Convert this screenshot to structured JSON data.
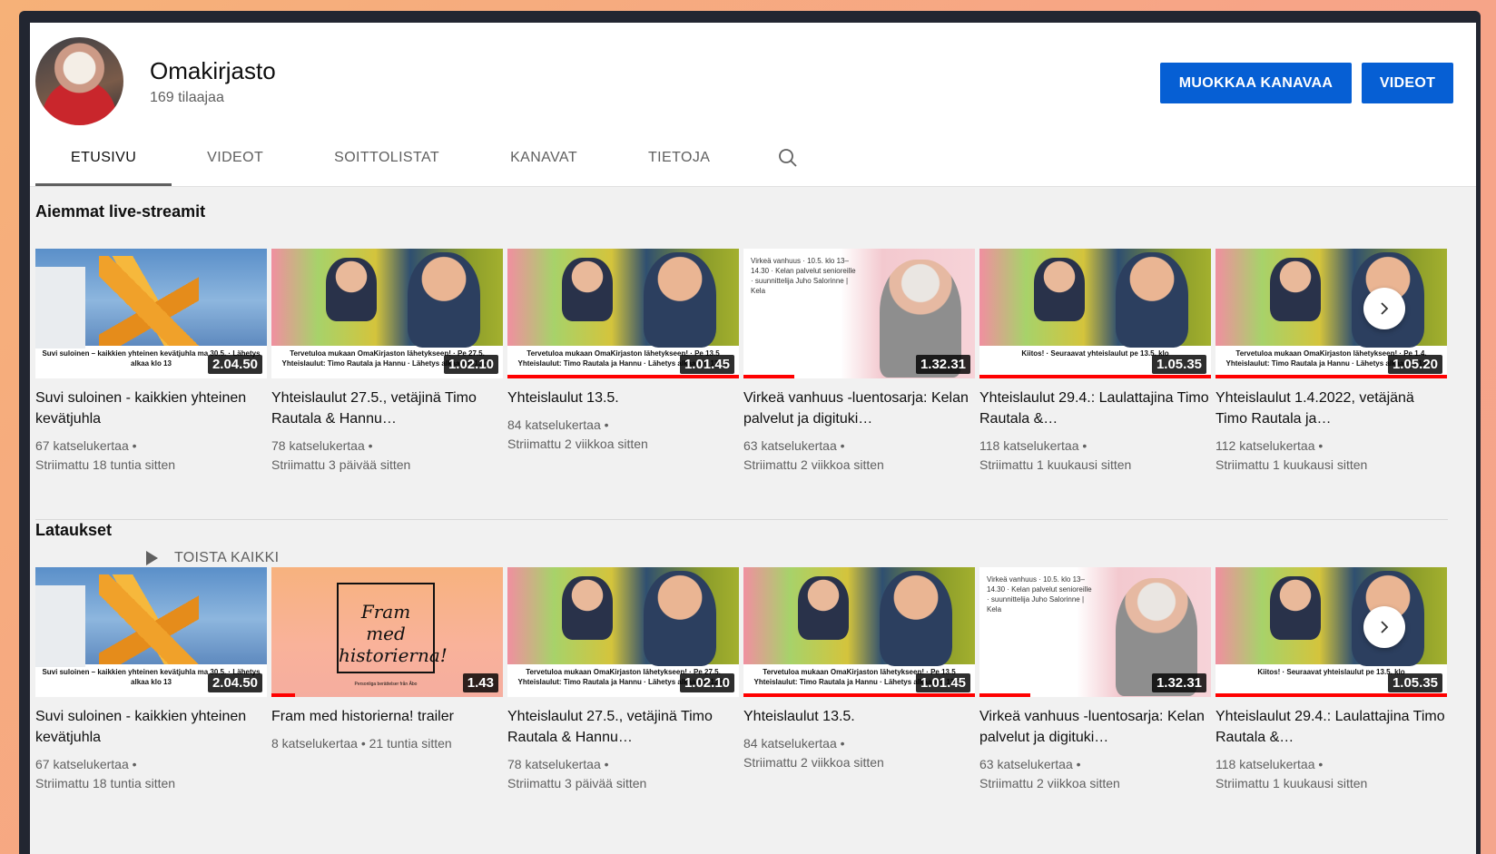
{
  "channel": {
    "name": "Omakirjasto",
    "subscribers": "169 tilaajaa",
    "edit_button": "MUOKKAA KANAVAA",
    "videos_button": "VIDEOT"
  },
  "tabs": [
    "ETUSIVU",
    "VIDEOT",
    "SOITTOLISTAT",
    "KANAVAT",
    "TIETOJA"
  ],
  "colors": {
    "accent": "#065fd4",
    "progress": "#ff0000"
  },
  "sections": {
    "live": {
      "title": "Aiemmat live-streamit",
      "videos": [
        {
          "title": "Suvi suloinen - kaikkien yhteinen kevätjuhla",
          "views": "67 katselukertaa •",
          "time": "Striimattu 18 tuntia sitten",
          "duration": "2.04.50",
          "progress": 0,
          "thumb": "sculpture",
          "caption": "Suvi suloinen – kaikkien yhteinen kevätjuhla ma 30.5. · Lähetys alkaa klo 13"
        },
        {
          "title": "Yhteislaulut 27.5., vetäjinä Timo Rautala & Hannu…",
          "views": "78 katselukertaa •",
          "time": "Striimattu 3 päivää sitten",
          "duration": "1.02.10",
          "progress": 0,
          "thumb": "singers",
          "caption": "Tervetuloa mukaan OmaKirjaston lähetykseen! · Pe 27.5. Yhteislaulut: Timo Rautala ja Hannu · Lähetys alkaa klo 13.30"
        },
        {
          "title": "Yhteislaulut 13.5.",
          "views": "84 katselukertaa •",
          "time": "Striimattu 2 viikkoa sitten",
          "duration": "1.01.45",
          "progress": 1,
          "thumb": "singers",
          "caption": "Tervetuloa mukaan OmaKirjaston lähetykseen! · Pe 13.5 Yhteislaulut: Timo Rautala ja Hannu · Lähetys alkaa klo 13.30"
        },
        {
          "title": "Virkeä vanhuus -luentosarja: Kelan palvelut ja digituki…",
          "views": "63 katselukertaa •",
          "time": "Striimattu 2 viikkoa sitten",
          "duration": "1.32.31",
          "progress": 0.22,
          "thumb": "virkea",
          "caption": "Virkeä vanhuus · 10.5. klo 13–14.30 · Kelan palvelut senioreille · suunnittelija Juho Salorinne | Kela"
        },
        {
          "title": "Yhteislaulut 29.4.: Laulattajina Timo Rautala &…",
          "views": "118 katselukertaa •",
          "time": "Striimattu 1 kuukausi sitten",
          "duration": "1.05.35",
          "progress": 1,
          "thumb": "singers",
          "caption": "Kiitos! · Seuraavat yhteislaulut pe 13.5. klo"
        },
        {
          "title": "Yhteislaulut 1.4.2022, vetäjänä Timo Rautala ja…",
          "views": "112 katselukertaa •",
          "time": "Striimattu 1 kuukausi sitten",
          "duration": "1.05.20",
          "progress": 1,
          "thumb": "singers",
          "caption": "Tervetuloa mukaan OmaKirjaston lähetykseen! · Pe 1.4. Yhteislaulut: Timo Rautala ja Hannu · Lähetys alkaa klo 13.30"
        }
      ]
    },
    "uploads": {
      "title": "Lataukset",
      "play_all": "TOISTA KAIKKI",
      "videos": [
        {
          "title": "Suvi suloinen - kaikkien yhteinen kevätjuhla",
          "views": "67 katselukertaa •",
          "time": "Striimattu 18 tuntia sitten",
          "duration": "2.04.50",
          "progress": 0,
          "thumb": "sculpture",
          "caption": "Suvi suloinen – kaikkien yhteinen kevätjuhla ma 30.5. · Lähetys alkaa klo 13"
        },
        {
          "title": "Fram med historierna! trailer",
          "views": "8 katselukertaa • 21 tuntia sitten",
          "time": "",
          "duration": "1.43",
          "progress": 0.1,
          "thumb": "fram",
          "caption": "Fram med historierna! · Personliga berättelser från Åbo"
        },
        {
          "title": "Yhteislaulut 27.5., vetäjinä Timo Rautala & Hannu…",
          "views": "78 katselukertaa •",
          "time": "Striimattu 3 päivää sitten",
          "duration": "1.02.10",
          "progress": 0,
          "thumb": "singers",
          "caption": "Tervetuloa mukaan OmaKirjaston lähetykseen! · Pe 27.5. Yhteislaulut: Timo Rautala ja Hannu · Lähetys alkaa klo 13.30"
        },
        {
          "title": "Yhteislaulut 13.5.",
          "views": "84 katselukertaa •",
          "time": "Striimattu 2 viikkoa sitten",
          "duration": "1.01.45",
          "progress": 1,
          "thumb": "singers",
          "caption": "Tervetuloa mukaan OmaKirjaston lähetykseen! · Pe 13.5 Yhteislaulut: Timo Rautala ja Hannu · Lähetys alkaa klo 13.30"
        },
        {
          "title": "Virkeä vanhuus -luentosarja: Kelan palvelut ja digituki…",
          "views": "63 katselukertaa •",
          "time": "Striimattu 2 viikkoa sitten",
          "duration": "1.32.31",
          "progress": 0.22,
          "thumb": "virkea",
          "caption": "Virkeä vanhuus · 10.5. klo 13–14.30 · Kelan palvelut senioreille · suunnittelija Juho Salorinne | Kela"
        },
        {
          "title": "Yhteislaulut 29.4.: Laulattajina Timo Rautala &…",
          "views": "118 katselukertaa •",
          "time": "Striimattu 1 kuukausi sitten",
          "duration": "1.05.35",
          "progress": 1,
          "thumb": "singers",
          "caption": "Kiitos! · Seuraavat yhteislaulut pe 13.5. klo"
        }
      ]
    }
  },
  "icons": {
    "search": "search-icon",
    "next": "chevron-right-icon",
    "play": "play-icon"
  }
}
